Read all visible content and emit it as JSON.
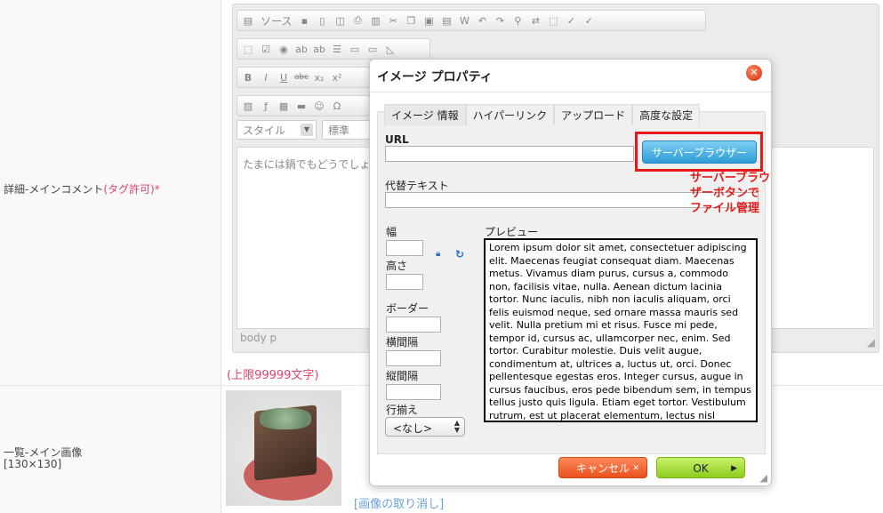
{
  "labels": {
    "detail_main_comment": "詳細-メインコメント",
    "detail_tag_allowed": "(タグ許可)*",
    "list_main_image": "一覧-メイン画像",
    "list_main_image_size": "[130×130]"
  },
  "editor": {
    "toolbar_source": "ソース",
    "style_combo": "スタイル",
    "format_combo": "標準",
    "content_text": "たまには鍋でもどうでしょ",
    "element_path": "body  p",
    "limit_text": "(上限99999文字)"
  },
  "image": {
    "cancel_link": "[画像の取り消し]"
  },
  "dialog": {
    "title": "イメージ プロパティ",
    "tabs": [
      "イメージ 情報",
      "ハイパーリンク",
      "アップロード",
      "高度な設定"
    ],
    "url_label": "URL",
    "url_value": "",
    "server_browser_button": "サーバーブラウザー",
    "annotation_line1": "サーバーブラウザーボタンで",
    "annotation_line2": "ファイル管理",
    "alt_label": "代替テキスト",
    "width_label": "幅",
    "height_label": "高さ",
    "border_label": "ボーダー",
    "hspace_label": "横間隔",
    "vspace_label": "縦間隔",
    "align_label": "行揃え",
    "align_value": "<なし>",
    "preview_label": "プレビュー",
    "preview_text": "Lorem ipsum dolor sit amet, consectetuer adipiscing elit. Maecenas feugiat consequat diam. Maecenas metus. Vivamus diam purus, cursus a, commodo non, facilisis vitae, nulla. Aenean dictum lacinia tortor. Nunc iaculis, nibh non iaculis aliquam, orci felis euismod neque, sed ornare massa mauris sed velit. Nulla pretium mi et risus. Fusce mi pede, tempor id, cursus ac, ullamcorper nec, enim. Sed tortor. Curabitur molestie. Duis velit augue, condimentum at, ultrices a, luctus ut, orci. Donec pellentesque egestas eros. Integer cursus, augue in cursus faucibus, eros pede bibendum sem, in tempus tellus justo quis ligula. Etiam eget tortor. Vestibulum rutrum, est ut placerat elementum, lectus nisl aliquam velit, tempor aliquam eros nunc nonummy metus. In eros metus, gravida a",
    "cancel_button": "キャンセル",
    "ok_button": "OK"
  }
}
